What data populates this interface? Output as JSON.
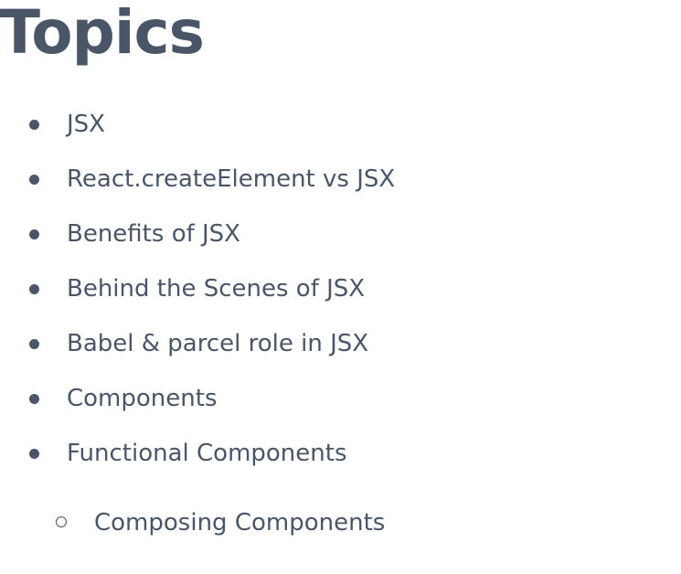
{
  "heading": "Topics",
  "topics": [
    {
      "label": "JSX"
    },
    {
      "label": "React.createElement vs JSX"
    },
    {
      "label": "Benefits of JSX"
    },
    {
      "label": "Behind the Scenes of JSX"
    },
    {
      "label": "Babel & parcel role in JSX"
    },
    {
      "label": "Components"
    },
    {
      "label": "Functional Components"
    }
  ],
  "subtopics": [
    {
      "label": "Composing Components"
    }
  ]
}
